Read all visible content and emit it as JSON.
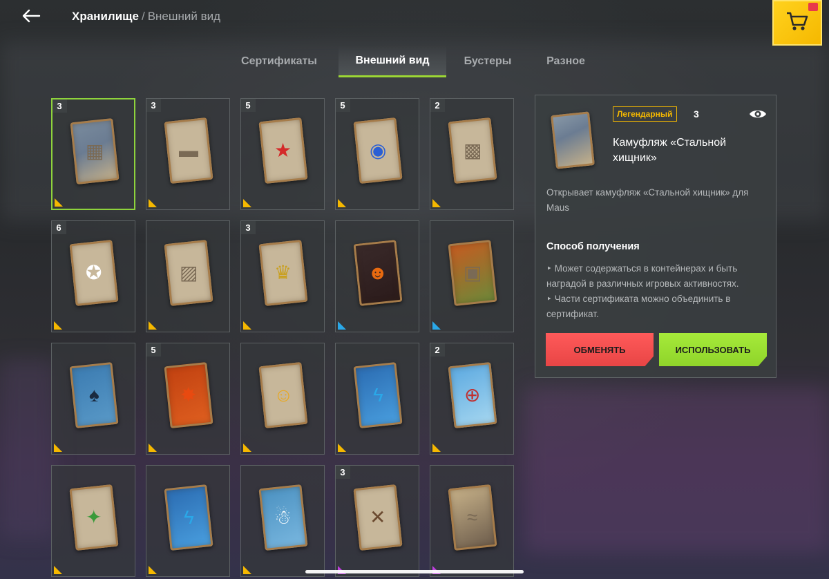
{
  "header": {
    "breadcrumb_root": "Хранилище",
    "breadcrumb_separator": "/",
    "breadcrumb_current": "Внешний вид"
  },
  "tabs": [
    {
      "label": "Сертификаты",
      "active": false
    },
    {
      "label": "Внешний вид",
      "active": true
    },
    {
      "label": "Бустеры",
      "active": false
    },
    {
      "label": "Разное",
      "active": false
    }
  ],
  "colors": {
    "accent_green": "#9cd734",
    "legendary": "#f5b800",
    "rare_blue": "#2aa8e8",
    "epic_purple": "#c040e0",
    "exchange_red": "#ff5a5a"
  },
  "grid": {
    "items": [
      {
        "count": "3",
        "rarity": "legendary",
        "icon": "camo-pattern-icon",
        "selected": true
      },
      {
        "count": "3",
        "rarity": "legendary",
        "icon": "flag-decal-icon"
      },
      {
        "count": "5",
        "rarity": "legendary",
        "icon": "red-star-icon"
      },
      {
        "count": "5",
        "rarity": "legendary",
        "icon": "roundel-icon"
      },
      {
        "count": "2",
        "rarity": "legendary",
        "icon": "grey-camo-icon"
      },
      {
        "count": "6",
        "rarity": "legendary",
        "icon": "white-star-icon"
      },
      {
        "count": "",
        "rarity": "legendary",
        "icon": "map-camo-icon"
      },
      {
        "count": "3",
        "rarity": "legendary",
        "icon": "eagle-emblem-icon"
      },
      {
        "count": "",
        "rarity": "rare",
        "icon": "pumpkin-icon"
      },
      {
        "count": "",
        "rarity": "rare",
        "icon": "tank-art-icon"
      },
      {
        "count": "",
        "rarity": "legendary",
        "icon": "bat-icon"
      },
      {
        "count": "5",
        "rarity": "legendary",
        "icon": "firework-icon"
      },
      {
        "count": "",
        "rarity": "legendary",
        "icon": "smiley-sunglasses-icon"
      },
      {
        "count": "",
        "rarity": "legendary",
        "icon": "lightning-turret-icon"
      },
      {
        "count": "2",
        "rarity": "legendary",
        "icon": "gatling-turret-icon"
      },
      {
        "count": "",
        "rarity": "legendary",
        "icon": "box-star-icon"
      },
      {
        "count": "",
        "rarity": "legendary",
        "icon": "electric-turret-icon"
      },
      {
        "count": "",
        "rarity": "legendary",
        "icon": "snowman-icon"
      },
      {
        "count": "3",
        "rarity": "epic",
        "icon": "cross-planks-icon"
      },
      {
        "count": "",
        "rarity": "epic",
        "icon": "wave-pattern-icon"
      }
    ]
  },
  "detail": {
    "rarity_label": "Легендарный",
    "count": "3",
    "title": "Камуфляж «Стальной хищник»",
    "description": "Открывает камуфляж «Стальной хищник» для Maus",
    "acquire_title": "Способ получения",
    "acquire_items": [
      "Может содержаться в контейнерах и быть наградой в различных игровых активностях.",
      "Части сертификата можно объединить в сертификат."
    ],
    "exchange_label": "ОБМЕНЯТЬ",
    "use_label": "ИСПОЛЬЗОВАТЬ"
  }
}
